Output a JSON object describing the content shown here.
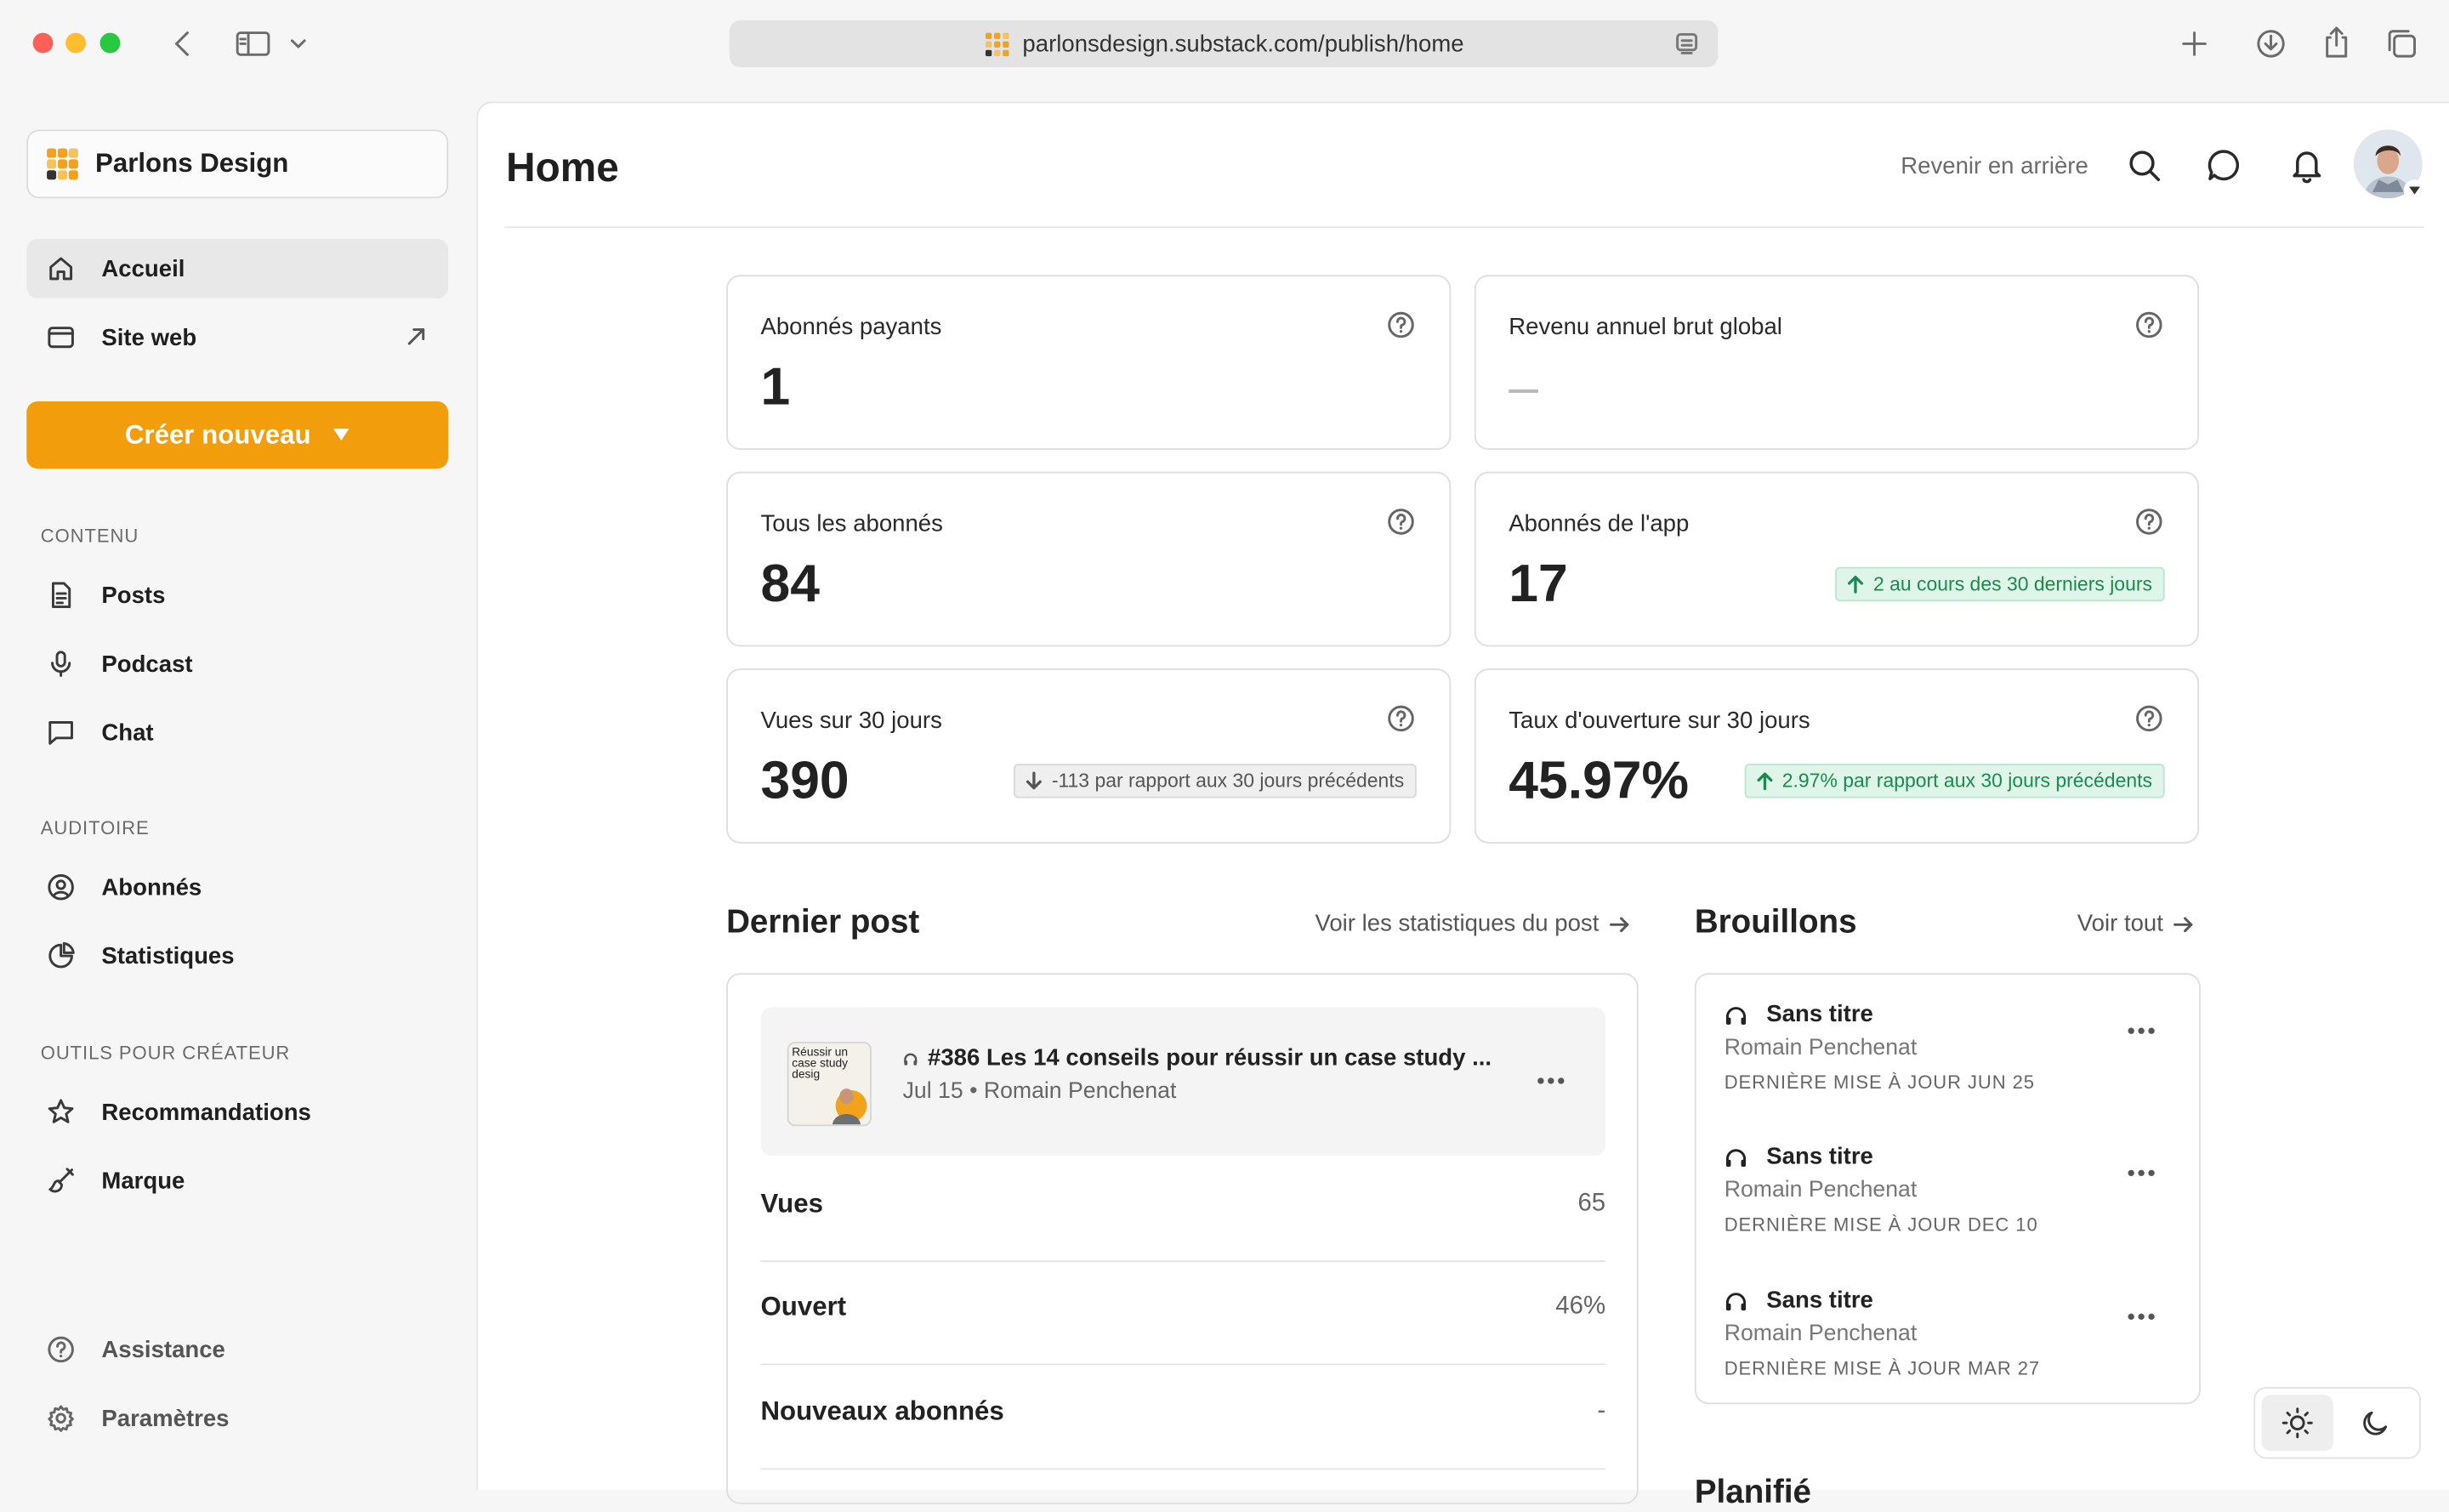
{
  "browser": {
    "url": "parlonsdesign.substack.com/publish/home"
  },
  "sidebar": {
    "publication_name": "Parlons Design",
    "nav_top": [
      {
        "label": "Accueil"
      },
      {
        "label": "Site web"
      }
    ],
    "create_label": "Créer nouveau",
    "section_content": "CONTENU",
    "content_items": [
      {
        "label": "Posts"
      },
      {
        "label": "Podcast"
      },
      {
        "label": "Chat"
      }
    ],
    "section_audience": "AUDITOIRE",
    "audience_items": [
      {
        "label": "Abonnés"
      },
      {
        "label": "Statistiques"
      }
    ],
    "section_tools": "OUTILS POUR CRÉATEUR",
    "tools_items": [
      {
        "label": "Recommandations"
      },
      {
        "label": "Marque"
      }
    ],
    "footer_items": [
      {
        "label": "Assistance"
      },
      {
        "label": "Paramètres"
      }
    ]
  },
  "header": {
    "title": "Home",
    "back_link": "Revenir en arrière"
  },
  "stats": [
    {
      "label": "Abonnés payants",
      "value": "1",
      "badge": null
    },
    {
      "label": "Revenu annuel brut global",
      "value": "–",
      "badge": null
    },
    {
      "label": "Tous les abonnés",
      "value": "84",
      "badge": null
    },
    {
      "label": "Abonnés de l'app",
      "value": "17",
      "badge": "2 au cours des 30 derniers jours",
      "trend": "up"
    },
    {
      "label": "Vues sur 30 jours",
      "value": "390",
      "badge": "-113 par rapport aux 30 jours précédents",
      "trend": "down"
    },
    {
      "label": "Taux d'ouverture sur 30 jours",
      "value": "45.97%",
      "badge": "2.97% par rapport aux 30 jours précédents",
      "trend": "up"
    }
  ],
  "last_post": {
    "section_title": "Dernier post",
    "stats_link": "Voir les statistiques du post",
    "title": "#386 Les 14 conseils pour réussir un case study ...",
    "date": "Jul 15",
    "author": "Romain Penchenat",
    "thumb_text": "Réussir un case study desig",
    "rows": [
      {
        "label": "Vues",
        "value": "65"
      },
      {
        "label": "Ouvert",
        "value": "46%"
      },
      {
        "label": "Nouveaux abonnés",
        "value": "-"
      }
    ]
  },
  "drafts": {
    "section_title": "Brouillons",
    "see_all": "Voir tout",
    "items": [
      {
        "title": "Sans titre",
        "author": "Romain Penchenat",
        "updated": "DERNIÈRE MISE À JOUR JUN 25"
      },
      {
        "title": "Sans titre",
        "author": "Romain Penchenat",
        "updated": "DERNIÈRE MISE À JOUR DEC 10"
      },
      {
        "title": "Sans titre",
        "author": "Romain Penchenat",
        "updated": "DERNIÈRE MISE À JOUR MAR 27"
      }
    ]
  },
  "next_section_peek": "Planifié",
  "colors": {
    "accent": "#f29d0b",
    "positive": "#1b8a4e",
    "positive_bg": "#dff5ea",
    "neutral_bg": "#efefef"
  },
  "icons": {
    "home": "home-icon",
    "website": "browser-window-icon",
    "posts": "document-icon",
    "podcast": "microphone-icon",
    "chat": "chat-bubble-icon",
    "subscribers": "user-circle-icon",
    "stats": "pie-chart-icon",
    "recommendations": "star-icon",
    "brand": "paintbrush-icon",
    "help": "question-circle-icon",
    "settings": "gear-icon"
  }
}
